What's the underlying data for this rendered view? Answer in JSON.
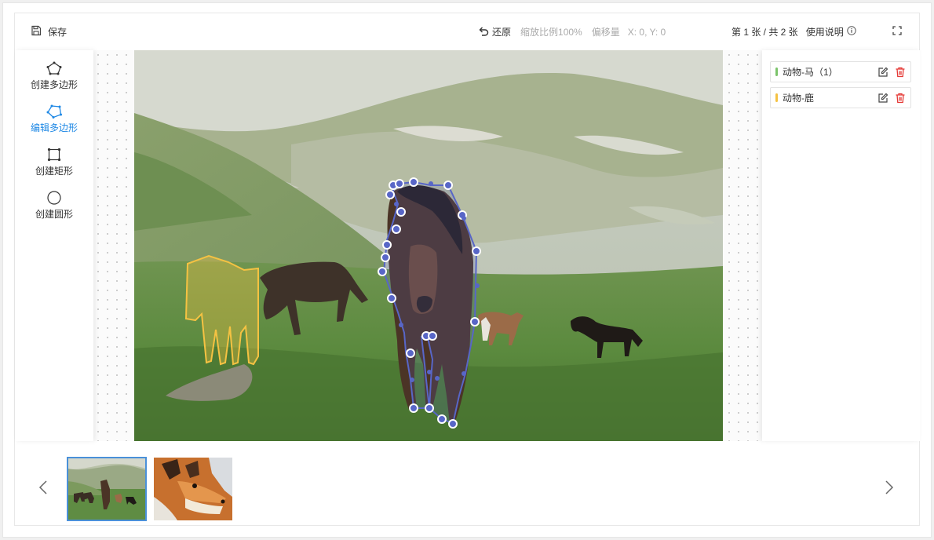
{
  "header": {
    "save_label": "保存",
    "undo_label": "还原",
    "zoom_text": "缩放比例100%",
    "offset_label": "偏移量",
    "offset_value": "X: 0, Y: 0",
    "page_text": "第 1 张 / 共 2 张",
    "help_label": "使用说明"
  },
  "toolbar": {
    "items": [
      {
        "label": "创建多边形",
        "icon": "polygon-icon",
        "active": false
      },
      {
        "label": "编辑多边形",
        "icon": "edit-polygon-icon",
        "active": true
      },
      {
        "label": "创建矩形",
        "icon": "rectangle-icon",
        "active": false
      },
      {
        "label": "创建圆形",
        "icon": "circle-icon",
        "active": false
      }
    ]
  },
  "labels": [
    {
      "name": "动物-马（1）",
      "color": "#7cc46b"
    },
    {
      "name": "动物-鹿",
      "color": "#f5c242"
    }
  ],
  "colors": {
    "accent": "#1e88e5",
    "polygon_blue": "#5866c7",
    "polygon_yellow": "#f5c242",
    "delete_red": "#e53935"
  },
  "thumbnails": [
    {
      "subject": "horses-landscape",
      "selected": true
    },
    {
      "subject": "fox-closeup",
      "selected": false
    }
  ]
}
